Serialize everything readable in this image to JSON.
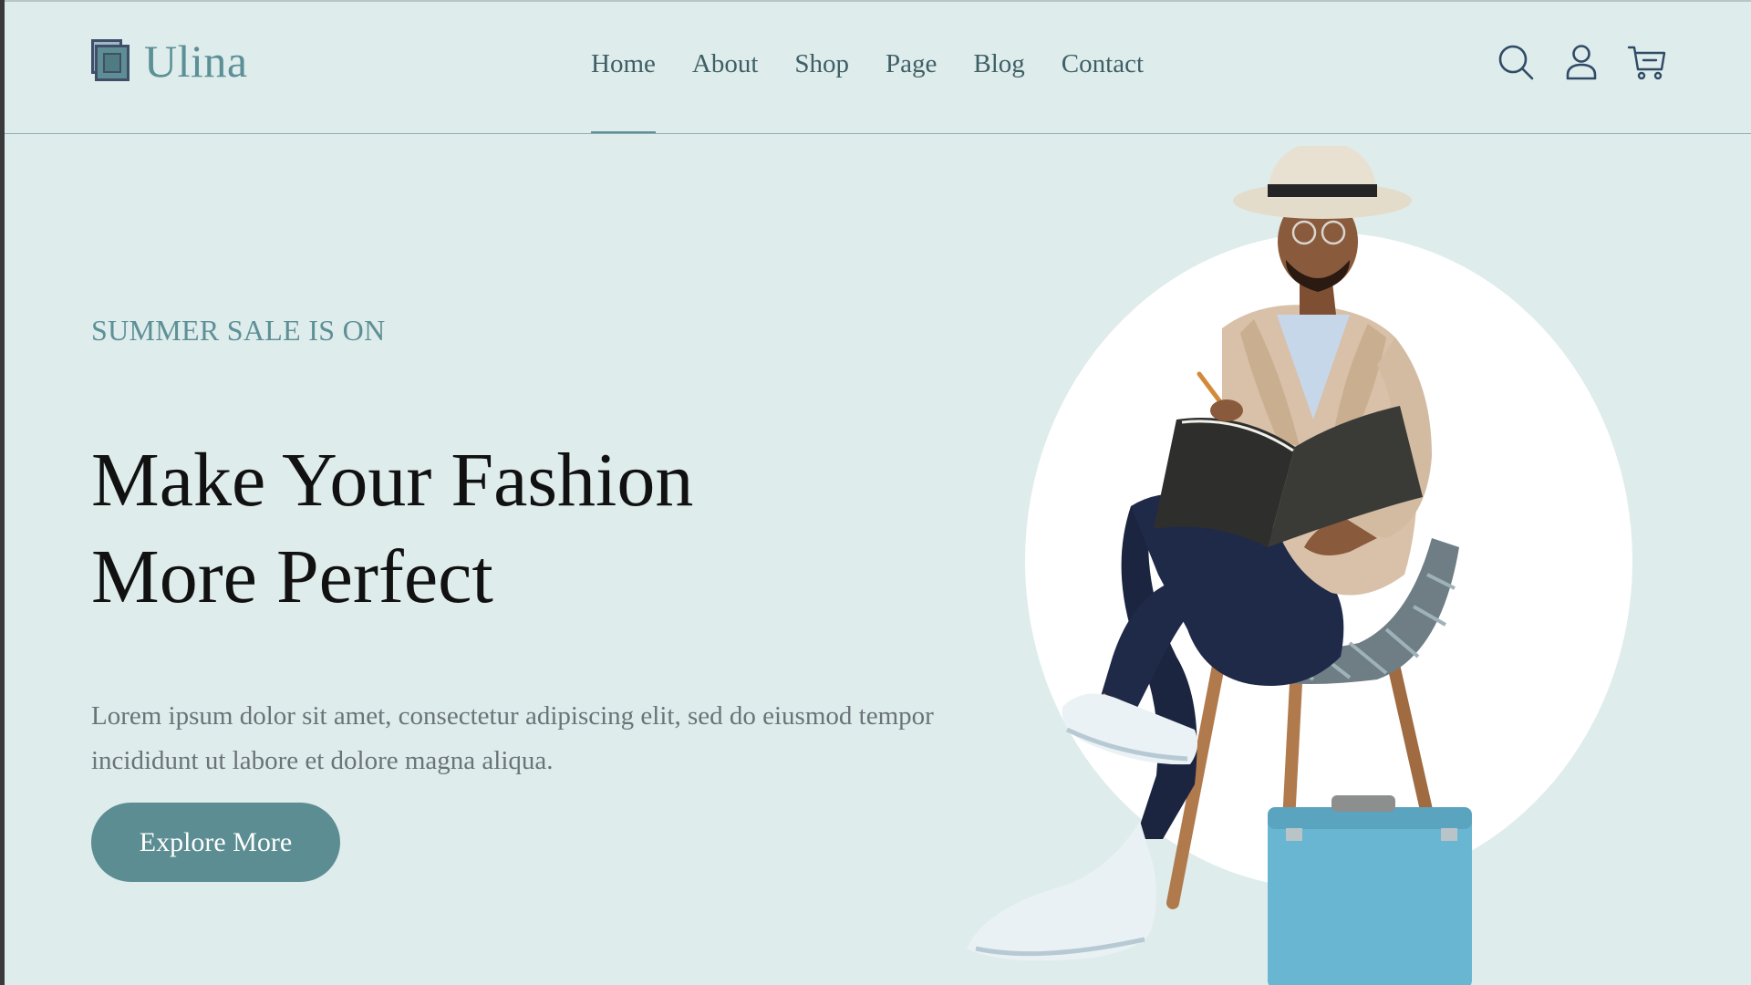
{
  "brand": {
    "name": "Ulina",
    "logo_icon": "stacked-squares-logo"
  },
  "nav": {
    "items": [
      {
        "label": "Home",
        "active": true
      },
      {
        "label": "About",
        "active": false
      },
      {
        "label": "Shop",
        "active": false
      },
      {
        "label": "Page",
        "active": false
      },
      {
        "label": "Blog",
        "active": false
      },
      {
        "label": "Contact",
        "active": false
      }
    ]
  },
  "header_icons": [
    "search-icon",
    "user-icon",
    "cart-icon"
  ],
  "hero": {
    "kicker": "SUMMER SALE IS ON",
    "headline_line1": "Make Your Fashion",
    "headline_line2": "More Perfect",
    "description": "Lorem ipsum dolor sit amet, consectetur adipiscing elit, sed do eiusmod tempor incididunt ut labore et dolore magna aliqua.",
    "cta_label": "Explore More"
  },
  "colors": {
    "background": "#deeceb",
    "accent": "#5b8d92",
    "nav_text": "#3e5f66",
    "headline": "#111111",
    "body_text": "#6a7478"
  }
}
